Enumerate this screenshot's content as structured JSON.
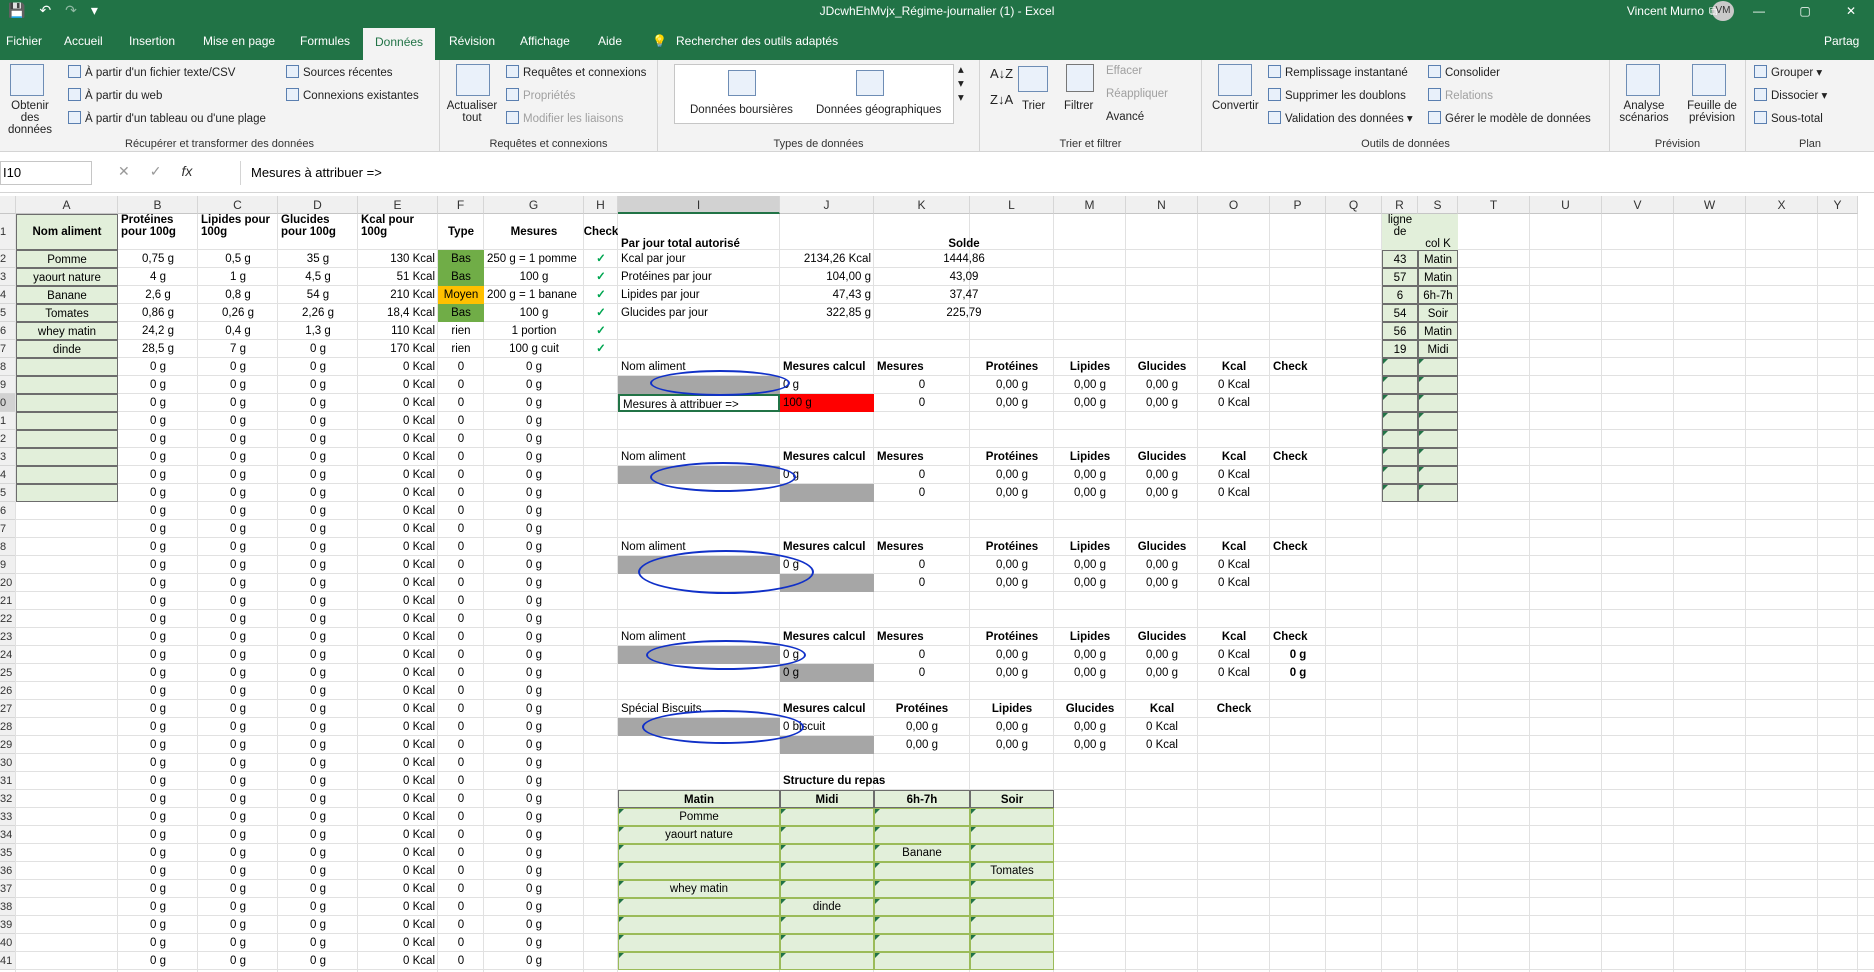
{
  "window": {
    "title": "JDcwhEhMvjx_Régime-journalier (1)  -  Excel",
    "user": "Vincent Murno",
    "initials": "VM",
    "quick_access": [
      "💾",
      "↶",
      "↷",
      "▾"
    ],
    "window_controls": [
      "—",
      "⧉",
      "▢",
      "✕"
    ]
  },
  "tabs": [
    "Fichier",
    "Accueil",
    "Insertion",
    "Mise en page",
    "Formules",
    "Données",
    "Révision",
    "Affichage",
    "Aide"
  ],
  "search_tools": "Rechercher des outils adaptés",
  "share": "Partag",
  "ribbon": {
    "get_data": "Obtenir des données",
    "from_csv": "À partir d'un fichier texte/CSV",
    "from_web": "À partir du web",
    "from_table": "À partir d'un tableau ou d'une plage",
    "recent_sources": "Sources récentes",
    "existing_conn": "Connexions existantes",
    "group_transform": "Récupérer et transformer des données",
    "refresh_all": "Actualiser tout",
    "queries_conn": "Requêtes et connexions",
    "properties": "Propriétés",
    "edit_links": "Modifier les liaisons",
    "group_queries": "Requêtes et connexions",
    "stocks": "Données boursières",
    "geo": "Données géographiques",
    "group_types": "Types de données",
    "sort": "Trier",
    "filter": "Filtrer",
    "clear": "Effacer",
    "reapply": "Réappliquer",
    "advanced": "Avancé",
    "group_sort": "Trier et filtrer",
    "convert": "Convertir",
    "flash_fill": "Remplissage instantané",
    "remove_dup": "Supprimer les doublons",
    "validation": "Validation des données",
    "consolidate": "Consolider",
    "relations": "Relations",
    "data_model": "Gérer le modèle de données",
    "group_tools": "Outils de données",
    "whatif": "Analyse scénarios",
    "forecast": "Feuille de prévision",
    "group_forecast": "Prévision",
    "group_btn": "Grouper",
    "ungroup": "Dissocier",
    "subtotal": "Sous-total",
    "group_outline": "Plan"
  },
  "formula_bar": {
    "name_box": "I10",
    "formula": "Mesures à attribuer =>",
    "icons": [
      "✕",
      "✓",
      "fx"
    ]
  },
  "columns": [
    "A",
    "B",
    "C",
    "D",
    "E",
    "F",
    "G",
    "H",
    "I",
    "J",
    "K",
    "L",
    "M",
    "N",
    "O",
    "P",
    "Q",
    "R",
    "S",
    "T",
    "U",
    "V",
    "W",
    "X",
    "Y"
  ],
  "rows": [
    "1",
    "2",
    "3",
    "4",
    "5",
    "6",
    "7",
    "8",
    "9",
    "0",
    "1",
    "2",
    "3",
    "4",
    "5",
    "6",
    "7",
    "8",
    "9",
    "20",
    "21",
    "22",
    "23",
    "24",
    "25",
    "26",
    "27",
    "28",
    "29",
    "30",
    "31",
    "32",
    "33",
    "34",
    "35",
    "36",
    "37",
    "38",
    "39",
    "40",
    "41"
  ],
  "headers": {
    "a": "Nom aliment",
    "b": "Protéines pour 100g",
    "c": "Lipides pour 100g",
    "d": "Glucides pour 100g",
    "e": "Kcal pour 100g",
    "f": "Type",
    "g": "Mesures",
    "h": "Check"
  },
  "foods": [
    {
      "name": "Pomme",
      "p": "0,75 g",
      "l": "0,5 g",
      "g": "35 g",
      "k": "130 Kcal",
      "type": "Bas",
      "mes": "250 g = 1 pomme",
      "check": "✓"
    },
    {
      "name": "yaourt nature",
      "p": "4 g",
      "l": "1 g",
      "g": "4,5 g",
      "k": "51 Kcal",
      "type": "Bas",
      "mes": "100 g",
      "check": "✓"
    },
    {
      "name": "Banane",
      "p": "2,6 g",
      "l": "0,8 g",
      "g": "54 g",
      "k": "210 Kcal",
      "type": "Moyen",
      "mes": "200 g = 1 banane",
      "check": "✓"
    },
    {
      "name": "Tomates",
      "p": "0,86 g",
      "l": "0,26 g",
      "g": "2,26 g",
      "k": "18,4 Kcal",
      "type": "Bas",
      "mes": "100 g",
      "check": "✓"
    },
    {
      "name": "whey matin",
      "p": "24,2 g",
      "l": "0,4 g",
      "g": "1,3 g",
      "k": "110 Kcal",
      "type": "rien",
      "mes": "1 portion",
      "check": "✓"
    },
    {
      "name": "dinde",
      "p": "28,5 g",
      "l": "7 g",
      "g": "0 g",
      "k": "170 Kcal",
      "type": "rien",
      "mes": "100 g cuit",
      "check": "✓"
    }
  ],
  "empty_row": {
    "g": "0 g",
    "k": "0 Kcal",
    "z": "0"
  },
  "totals": {
    "title": "Par jour total autorisé",
    "solde": "Solde",
    "rows": [
      {
        "label": "Kcal par jour",
        "val": "2134,26 Kcal",
        "solde": "1444,86"
      },
      {
        "label": "Protéines par jour",
        "val": "104,00 g",
        "solde": "43,09"
      },
      {
        "label": "Lipides par jour",
        "val": "47,43 g",
        "solde": "37,47"
      },
      {
        "label": "Glucides par jour",
        "val": "322,85 g",
        "solde": "225,79"
      }
    ]
  },
  "calc": {
    "nom": "Nom aliment",
    "mes_calc": "Mesures calcul",
    "mes": "Mesures",
    "prot": "Protéines",
    "lip": "Lipides",
    "glu": "Glucides",
    "kcal": "Kcal",
    "check": "Check",
    "attr": "Mesures à attribuer =>",
    "g0": "0 g",
    "g100": "100 g",
    "zero": "0",
    "p0": "0,00 g",
    "k0": "0 Kcal",
    "special": "Spécial Biscuits",
    "biscuit": "0 biscuit"
  },
  "side": {
    "h1": "ligne de",
    "h2": "col K",
    "rows": [
      {
        "n": "43",
        "m": "Matin"
      },
      {
        "n": "57",
        "m": "Matin"
      },
      {
        "n": "6",
        "m": "6h-7h"
      },
      {
        "n": "54",
        "m": "Soir"
      },
      {
        "n": "56",
        "m": "Matin"
      },
      {
        "n": "19",
        "m": "Midi"
      }
    ]
  },
  "structure": {
    "title": "Structure du repas",
    "cols": [
      "Matin",
      "Midi",
      "6h-7h",
      "Soir"
    ],
    "items": [
      {
        "row": 0,
        "col": 0,
        "v": "Pomme"
      },
      {
        "row": 1,
        "col": 0,
        "v": "yaourt nature"
      },
      {
        "row": 2,
        "col": 2,
        "v": "Banane"
      },
      {
        "row": 3,
        "col": 3,
        "v": "Tomates"
      },
      {
        "row": 4,
        "col": 0,
        "v": "whey matin"
      },
      {
        "row": 5,
        "col": 1,
        "v": "dinde"
      }
    ]
  }
}
